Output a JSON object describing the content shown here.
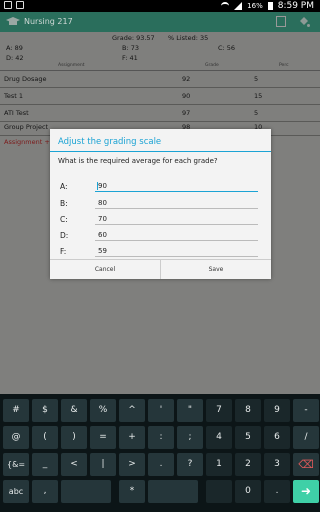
{
  "status_bar": {
    "battery": "16%",
    "time": "8:59 PM"
  },
  "app": {
    "title": "Nursing 217"
  },
  "summary": {
    "grade": "Grade: 93.57",
    "listed": "% Listed: 35"
  },
  "distribution": [
    {
      "label": "A: 89"
    },
    {
      "label": "B: 73"
    },
    {
      "label": "C: 56"
    },
    {
      "label": "D: 42"
    },
    {
      "label": "F: 41"
    }
  ],
  "table": {
    "headers": {
      "assignment": "Assignment",
      "grade": "Grade",
      "perc": "Perc"
    },
    "rows": [
      {
        "name": "Drug Dosage",
        "grade": "92",
        "perc": "5"
      },
      {
        "name": "Test 1",
        "grade": "90",
        "perc": "15"
      },
      {
        "name": "ATI Test",
        "grade": "97",
        "perc": "5"
      },
      {
        "name": "Group Project",
        "grade": "98",
        "perc": "10"
      }
    ],
    "add_link": "Assignment +"
  },
  "dialog": {
    "title": "Adjust the grading scale",
    "question": "What is the required average for each grade?",
    "grades": [
      {
        "letter": "A:",
        "value": "90"
      },
      {
        "letter": "B:",
        "value": "80"
      },
      {
        "letter": "C:",
        "value": "70"
      },
      {
        "letter": "D:",
        "value": "60"
      },
      {
        "letter": "F:",
        "value": "59"
      }
    ],
    "cancel": "Cancel",
    "save": "Save"
  },
  "keyboard": {
    "row1": [
      "#",
      "$",
      "&",
      "%",
      "^",
      "'",
      "\"",
      "7",
      "8",
      "9",
      "-"
    ],
    "row2": [
      "@",
      "(",
      ")",
      "=",
      "+",
      ":",
      ";",
      "4",
      "5",
      "6",
      "/"
    ],
    "row3": [
      "{&=",
      "_",
      "<",
      "|",
      ">",
      ".",
      "?",
      "1",
      "2",
      "3",
      "⌫"
    ],
    "row4": [
      "abc",
      ",",
      "*",
      "0",
      "."
    ]
  },
  "colors": {
    "accent": "#1ba3d4",
    "appbar": "#2a6e5c",
    "key_green": "#3fd0a7"
  }
}
